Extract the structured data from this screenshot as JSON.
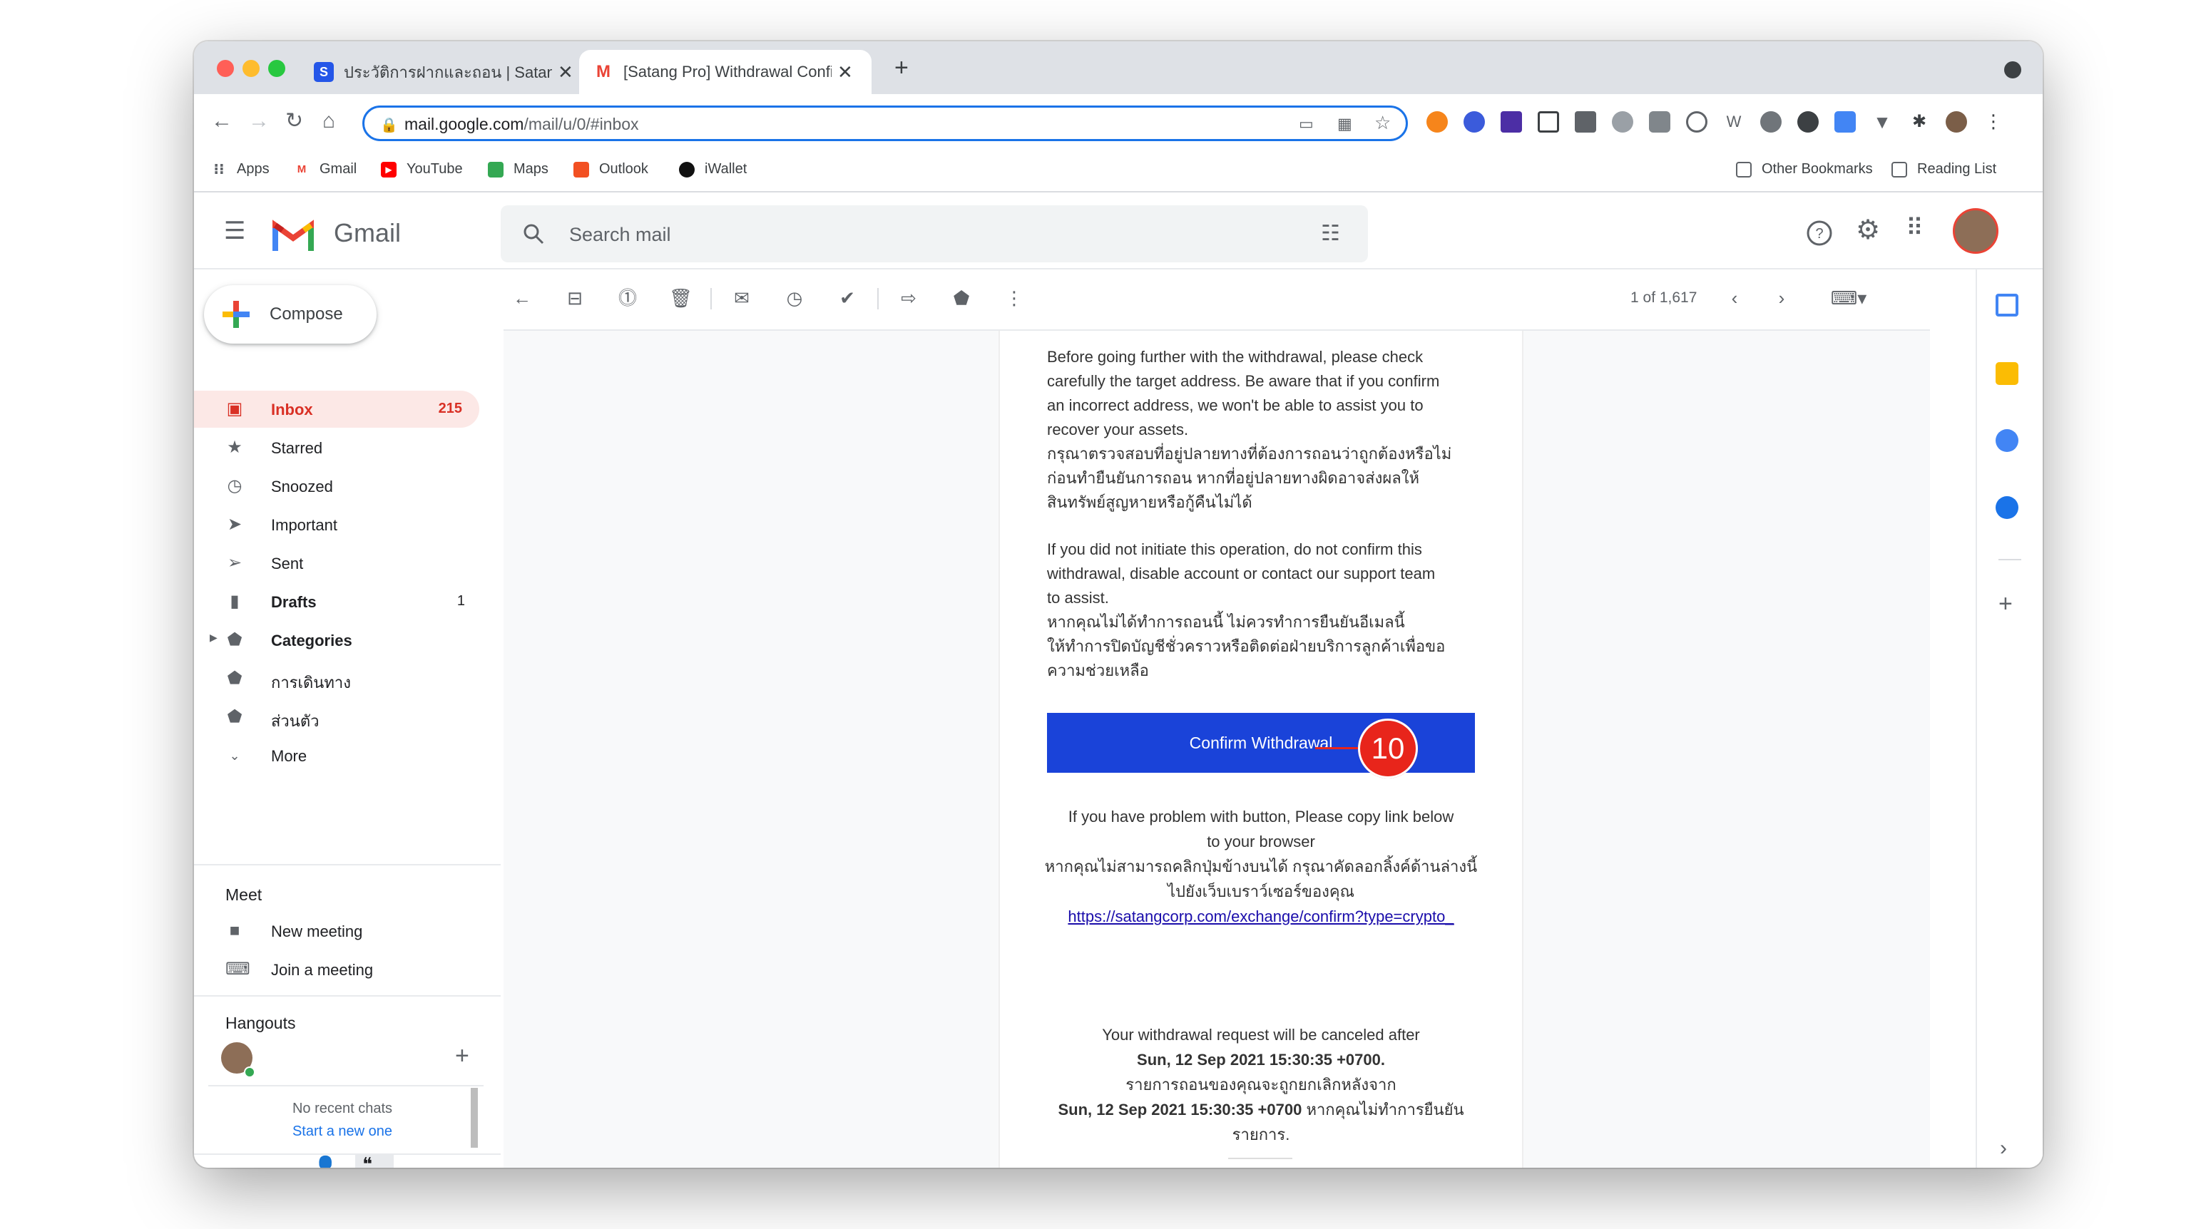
{
  "browser": {
    "tabs": [
      {
        "title": "ประวัติการฝากและถอน | Satangco",
        "favicon": "satang-favicon"
      },
      {
        "title": "[Satang Pro] Withdrawal Confir",
        "favicon": "gmail-favicon"
      }
    ],
    "url_host": "mail.google.com",
    "url_path": "/mail/u/0/#inbox",
    "bookmarks": [
      "Apps",
      "Gmail",
      "YouTube",
      "Maps",
      "Outlook",
      "iWallet"
    ],
    "other_bookmarks": "Other Bookmarks",
    "reading_list": "Reading List"
  },
  "gmail": {
    "app_name": "Gmail",
    "search_placeholder": "Search mail",
    "compose_label": "Compose",
    "nav": [
      {
        "label": "Inbox",
        "count": "215",
        "icon": "inbox-icon"
      },
      {
        "label": "Starred",
        "count": "",
        "icon": "star-icon"
      },
      {
        "label": "Snoozed",
        "count": "",
        "icon": "clock-icon"
      },
      {
        "label": "Important",
        "count": "",
        "icon": "important-icon"
      },
      {
        "label": "Sent",
        "count": "",
        "icon": "send-icon"
      },
      {
        "label": "Drafts",
        "count": "1",
        "icon": "draft-icon"
      },
      {
        "label": "Categories",
        "count": "",
        "icon": "label-icon"
      },
      {
        "label": "การเดินทาง",
        "count": "",
        "icon": "label-icon"
      },
      {
        "label": "ส่วนตัว",
        "count": "",
        "icon": "label-icon"
      },
      {
        "label": "More",
        "count": "",
        "icon": "chevron-down-icon"
      }
    ],
    "meet": {
      "title": "Meet",
      "new_meeting": "New meeting",
      "join_meeting": "Join a meeting"
    },
    "hangouts": {
      "title": "Hangouts",
      "no_recent": "No recent chats",
      "start_new": "Start a new one"
    },
    "pagination": "1 of 1,617"
  },
  "email": {
    "warning_en": [
      "Before going further with the withdrawal, please check",
      "carefully the target address. Be aware that if you confirm",
      "an incorrect address, we won't be able to assist you to",
      "recover your assets."
    ],
    "warning_th": [
      "กรุณาตรวจสอบที่อยู่ปลายทางที่ต้องการถอนว่าถูกต้องหรือไม่",
      "ก่อนทำยืนยันการถอน หากที่อยู่ปลายทางผิดอาจส่งผลให้",
      "สินทรัพย์สูญหายหรือกู้คืนไม่ได้"
    ],
    "notice_en": [
      "If you did not initiate this operation, do not confirm this",
      "withdrawal, disable account or contact our support team",
      "to assist."
    ],
    "notice_th": [
      "หากคุณไม่ได้ทำการถอนนี้ ไม่ควรทำการยืนยันอีเมลนี้",
      "ให้ทำการปิดบัญชีชั่วคราวหรือติดต่อฝ่ายบริการลูกค้าเพื่อขอ",
      "ความช่วยเหลือ"
    ],
    "confirm_button": "Confirm Withdrawal",
    "step_badge": "10",
    "link_help_en_1": "If you have problem with button, Please copy link below",
    "link_help_en_2": "to your browser",
    "link_help_th_1": "หากคุณไม่สามารถคลิกปุ่มข้างบนได้ กรุณาคัดลอกลิ้งค์ด้านล่างนี้",
    "link_help_th_2": "ไปยังเว็บเบราว์เซอร์ของคุณ",
    "confirm_link": "https://satangcorp.com/exchange/confirm?type=crypto_",
    "cancel_en": "Your withdrawal request will be canceled after",
    "cancel_date_1": "Sun, 12 Sep 2021 15:30:35 +0700.",
    "cancel_th": "รายการถอนของคุณจะถูกยกเลิกหลังจาก",
    "cancel_date_2": "Sun, 12 Sep 2021 15:30:35 +0700",
    "cancel_th_tail": " หากคุณไม่ทำการยืนยัน",
    "cancel_th_end": "รายการ."
  },
  "colors": {
    "confirm_button": "#1a43d9",
    "badge": "#e8251b",
    "inbox_active_bg": "#fce8e6",
    "inbox_active_text": "#d93025",
    "omnibox_border": "#1a73e8"
  }
}
